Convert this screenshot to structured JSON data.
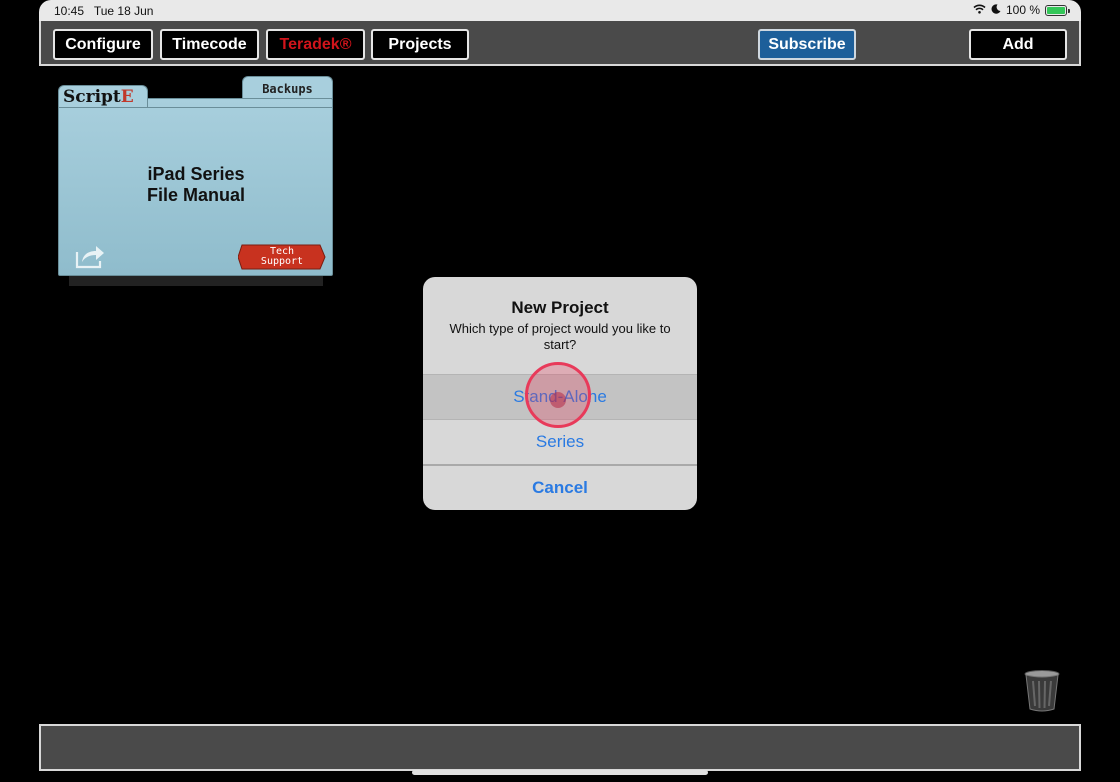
{
  "status_bar": {
    "time": "10:45",
    "date": "Tue 18 Jun",
    "battery": "100 %",
    "battery_level": 1.0
  },
  "toolbar": {
    "configure": "Configure",
    "timecode": "Timecode",
    "teradek": "Teradek®",
    "projects": "Projects",
    "subscribe": "Subscribe",
    "add": "Add"
  },
  "folder": {
    "tab_left": "ScriptE",
    "tab_backups": "Backups",
    "title_line1": "iPad Series",
    "title_line2": "File Manual",
    "tech_support_line1": "Tech",
    "tech_support_line2": "Support"
  },
  "dialog": {
    "title": "New Project",
    "message": "Which type of project would you like to start?",
    "option_standalone": "Stand-Alone",
    "option_series": "Series",
    "cancel": "Cancel"
  },
  "icons": [
    "wifi-icon",
    "moon-icon",
    "battery-icon",
    "share-icon",
    "trash-icon"
  ],
  "colors": {
    "accent_red": "#d1141b",
    "subscribe_blue": "#1d5f9a",
    "dialog_link": "#2a7ae2",
    "folder_blue": "#a8cfdd"
  }
}
